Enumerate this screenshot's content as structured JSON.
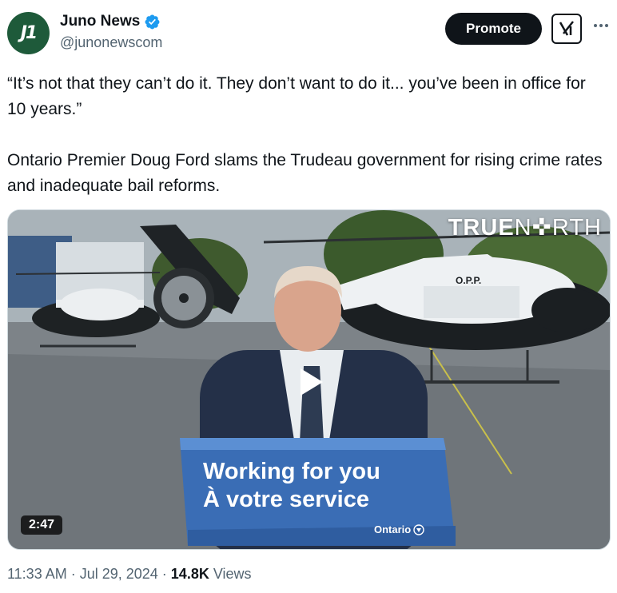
{
  "author": {
    "display_name": "Juno News",
    "handle": "@junonewscom",
    "avatar_text": "J1",
    "verified": true
  },
  "actions": {
    "promote_label": "Promote",
    "grok_icon": "grok-icon",
    "more_icon": "more-icon"
  },
  "tweet": {
    "paragraphs": [
      "“It’s not that they can’t do it. They don’t want to do it... you’ve been in office for 10 years.”",
      "Ontario Premier Doug Ford slams the Trudeau government for rising crime rates and inadequate bail reforms."
    ]
  },
  "media": {
    "watermark_bold": "TRUE",
    "watermark_thin": "N✜RTH",
    "duration": "2:47",
    "podium_line1": "Working for you",
    "podium_line2": "À votre service",
    "podium_logo": "Ontario",
    "helicopter_label": "O.P.P."
  },
  "meta": {
    "time": "11:33 AM",
    "separator": "·",
    "date": "Jul 29, 2024",
    "views_count": "14.8K",
    "views_label": "Views"
  },
  "colors": {
    "avatar_bg": "#1e5a3a",
    "verified": "#1d9bf0",
    "promote_bg": "#0f1419",
    "secondary_text": "#536471",
    "podium_blue": "#3a6db5"
  }
}
